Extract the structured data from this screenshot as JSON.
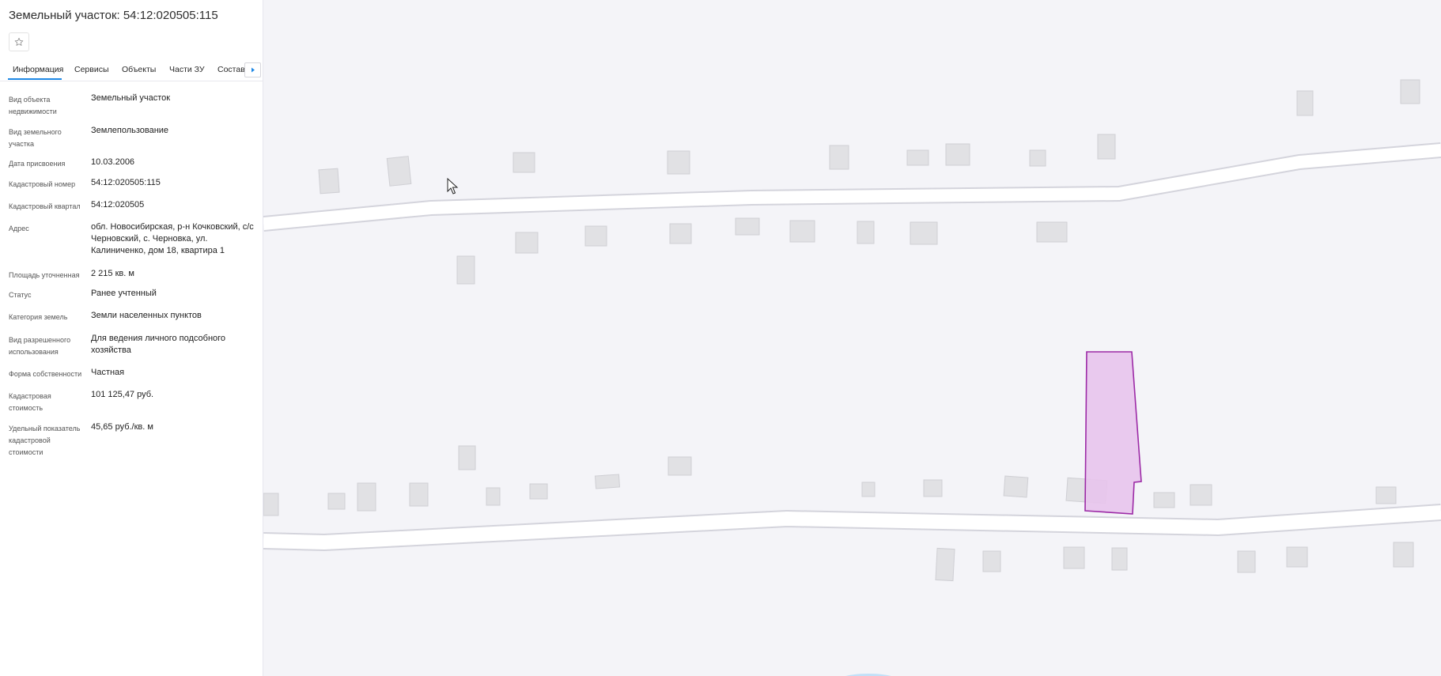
{
  "header": {
    "title": "Земельный участок: 54:12:020505:115",
    "favorite_icon": "star-outline-icon"
  },
  "tabs": [
    {
      "label": "Информация",
      "active": true
    },
    {
      "label": "Сервисы"
    },
    {
      "label": "Объекты"
    },
    {
      "label": "Части ЗУ"
    },
    {
      "label": "Состав"
    }
  ],
  "tabs_next_icon": "chevron-right-icon",
  "details": [
    {
      "label": "Вид объекта недвижимости",
      "value": "Земельный участок"
    },
    {
      "label": "Вид земельного участка",
      "value": "Землепользование"
    },
    {
      "label": "Дата присвоения",
      "value": "10.03.2006"
    },
    {
      "label": "Кадастровый номер",
      "value": "54:12:020505:115"
    },
    {
      "label": "Кадастровый квартал",
      "value": "54:12:020505"
    },
    {
      "label": "Адрес",
      "value": "обл. Новосибирская, р-н Кочковский, с/с Черновский, с. Черновка, ул. Калиниченко, дом 18, квартира 1"
    },
    {
      "label": "Площадь уточненная",
      "value": "2 215 кв. м"
    },
    {
      "label": "Статус",
      "value": "Ранее учтенный"
    },
    {
      "label": "Категория земель",
      "value": "Земли населенных пунктов"
    },
    {
      "label": "Вид разрешенного использования",
      "value": "Для ведения личного подсобного хозяйства"
    },
    {
      "label": "Форма собственности",
      "value": "Частная"
    },
    {
      "label": "Кадастровая стоимость",
      "value": "101 125,47 руб."
    },
    {
      "label": "Удельный показатель кадастровой стоимости",
      "value": "45,65 руб./кв. м"
    }
  ],
  "map": {
    "colors": {
      "background": "#f4f4f8",
      "road_fill": "#ffffff",
      "road_edge": "#d4d4dc",
      "building_fill": "#e1e1e4",
      "building_edge": "#cfcfd4",
      "parcel_fill": "#e8c4ec",
      "parcel_stroke": "#9c2aa6"
    },
    "cursor_icon": "mouse-pointer-icon"
  }
}
